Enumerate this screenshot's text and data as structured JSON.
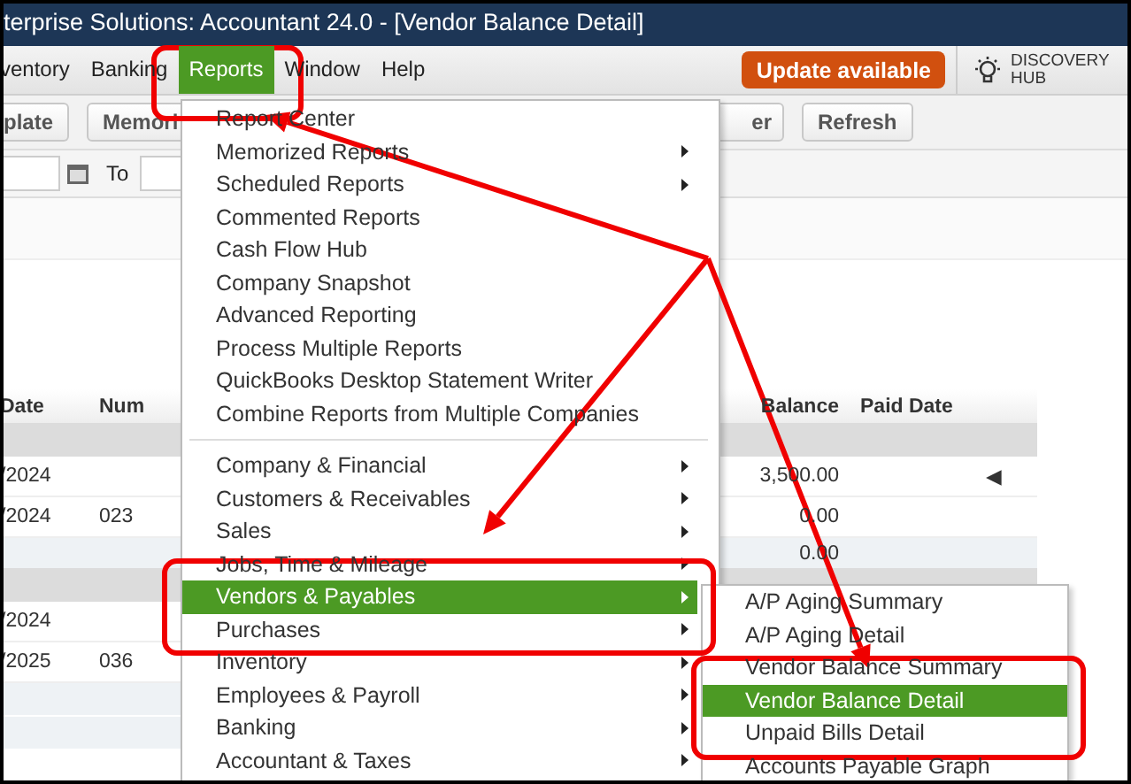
{
  "window": {
    "title": "terprise Solutions: Accountant 24.0 - [Vendor Balance Detail]"
  },
  "menubar": {
    "items": [
      {
        "label": "ventory",
        "selected": false
      },
      {
        "label": "Banking",
        "selected": false
      },
      {
        "label": "Reports",
        "selected": true
      },
      {
        "label": "Window",
        "selected": false
      },
      {
        "label": "Help",
        "selected": false
      }
    ],
    "update_button": "Update available",
    "discovery_hub": "DISCOVERY HUB"
  },
  "toolbar": {
    "buttons": [
      "plate",
      "Memori",
      "er",
      "Refresh"
    ]
  },
  "date_filter": {
    "to_label": "To"
  },
  "report": {
    "columns": [
      {
        "label": "Date",
        "kind": "text"
      },
      {
        "label": "Num",
        "kind": "text"
      },
      {
        "label": "Balance",
        "kind": "amount"
      },
      {
        "label": "Paid Date",
        "kind": "text"
      }
    ],
    "rows": [
      {
        "kind": "group"
      },
      {
        "kind": "row",
        "date": "/2024",
        "balance": "3,500.00",
        "marker": "◀"
      },
      {
        "kind": "row",
        "date": "/2024",
        "num": "023",
        "balance": "0.00"
      },
      {
        "kind": "total",
        "balance": "0.00"
      },
      {
        "kind": "group"
      },
      {
        "kind": "row",
        "date": "/2024"
      },
      {
        "kind": "row",
        "date": "/2025",
        "num": "036"
      },
      {
        "kind": "blank"
      },
      {
        "kind": "blank"
      }
    ]
  },
  "reports_menu": {
    "items": [
      {
        "kind": "item",
        "label": "Report Center",
        "submenu": false,
        "selected": false
      },
      {
        "kind": "item",
        "label": "Memorized Reports",
        "submenu": true,
        "selected": false
      },
      {
        "kind": "item",
        "label": "Scheduled Reports",
        "submenu": true,
        "selected": false
      },
      {
        "kind": "item",
        "label": "Commented Reports",
        "submenu": false,
        "selected": false
      },
      {
        "kind": "item",
        "label": "Cash Flow Hub",
        "submenu": false,
        "selected": false
      },
      {
        "kind": "item",
        "label": "Company Snapshot",
        "submenu": false,
        "selected": false
      },
      {
        "kind": "item",
        "label": "Advanced Reporting",
        "submenu": false,
        "selected": false
      },
      {
        "kind": "item",
        "label": "Process Multiple Reports",
        "submenu": false,
        "selected": false
      },
      {
        "kind": "item",
        "label": "QuickBooks Desktop Statement Writer",
        "submenu": false,
        "selected": false
      },
      {
        "kind": "item",
        "label": "Combine Reports from Multiple Companies",
        "submenu": false,
        "selected": false
      },
      {
        "kind": "separator"
      },
      {
        "kind": "item",
        "label": "Company & Financial",
        "submenu": true,
        "selected": false
      },
      {
        "kind": "item",
        "label": "Customers & Receivables",
        "submenu": true,
        "selected": false
      },
      {
        "kind": "item",
        "label": "Sales",
        "submenu": true,
        "selected": false
      },
      {
        "kind": "item",
        "label": "Jobs, Time & Mileage",
        "submenu": true,
        "selected": false
      },
      {
        "kind": "item",
        "label": "Vendors & Payables",
        "submenu": true,
        "selected": true
      },
      {
        "kind": "item",
        "label": "Purchases",
        "submenu": true,
        "selected": false
      },
      {
        "kind": "item",
        "label": "Inventory",
        "submenu": true,
        "selected": false
      },
      {
        "kind": "item",
        "label": "Employees & Payroll",
        "submenu": true,
        "selected": false
      },
      {
        "kind": "item",
        "label": "Banking",
        "submenu": true,
        "selected": false
      },
      {
        "kind": "item",
        "label": "Accountant & Taxes",
        "submenu": true,
        "selected": false
      }
    ]
  },
  "vendors_submenu": {
    "items": [
      {
        "kind": "item",
        "label": "A/P Aging Summary",
        "submenu": false,
        "selected": false
      },
      {
        "kind": "item",
        "label": "A/P Aging Detail",
        "submenu": false,
        "selected": false
      },
      {
        "kind": "item",
        "label": "Vendor Balance Summary",
        "submenu": false,
        "selected": false
      },
      {
        "kind": "item",
        "label": "Vendor Balance Detail",
        "submenu": false,
        "selected": true
      },
      {
        "kind": "item",
        "label": "Unpaid Bills Detail",
        "submenu": false,
        "selected": false
      },
      {
        "kind": "item",
        "label": "Accounts Payable Graph",
        "submenu": false,
        "selected": false
      }
    ]
  }
}
